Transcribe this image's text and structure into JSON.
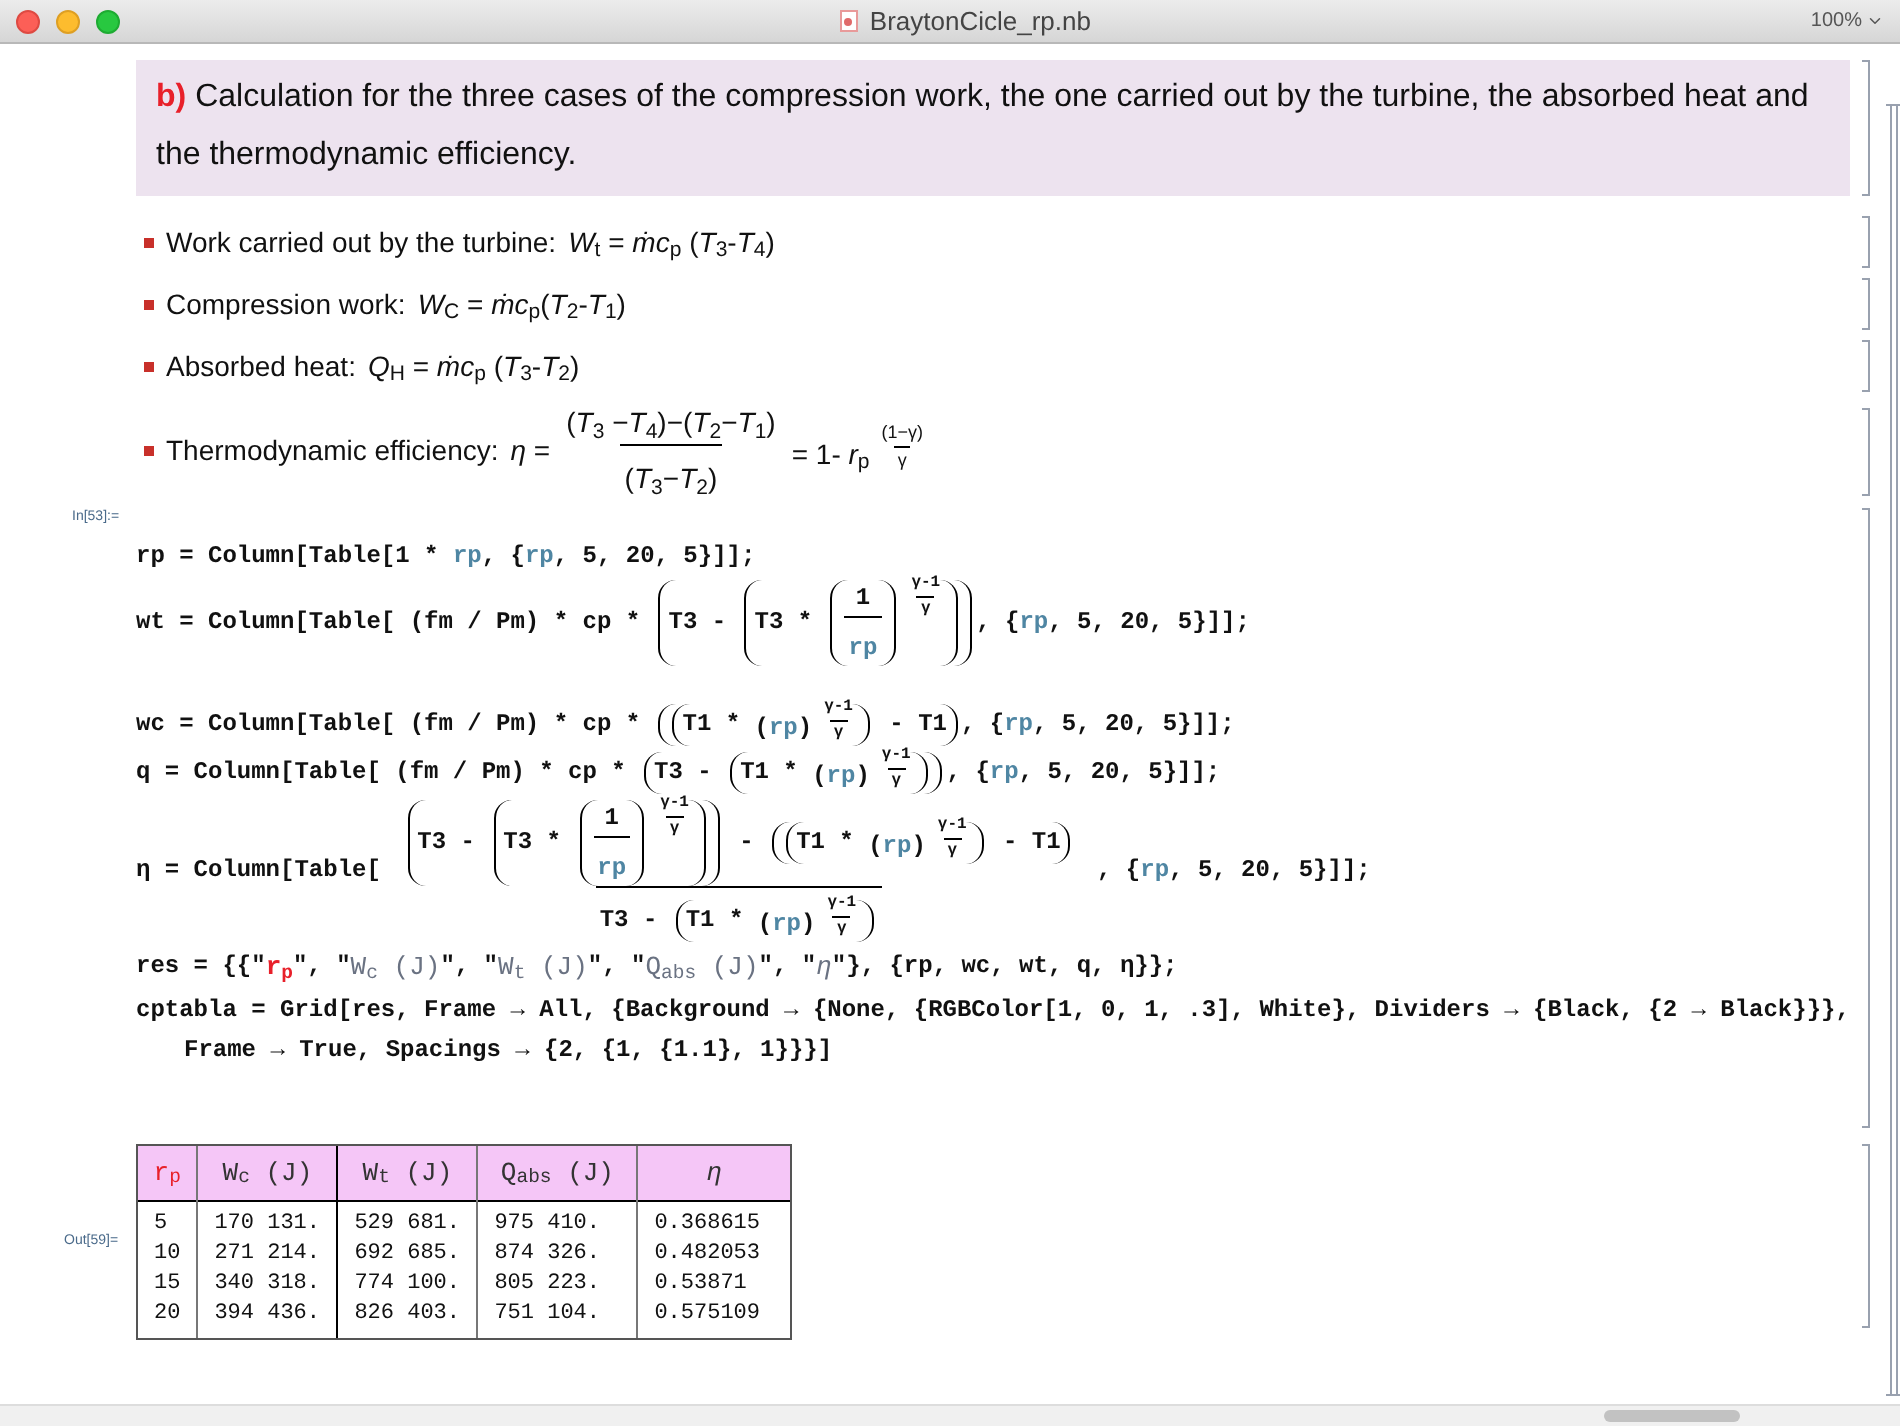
{
  "window": {
    "title": "BraytonCicle_rp.nb",
    "zoom": "100%"
  },
  "text_cell": {
    "label": "b)",
    "text": "Calculation for the three cases of the compression work, the one carried out by the turbine, the absorbed heat and the thermodynamic efficiency."
  },
  "bullets": [
    {
      "label": "Work carried out by the turbine:",
      "math": [
        {
          "kind": "math",
          "text": "*W*$_{t}$ = *ṁc*$_{p}$ (*T*$_{3}$-*T*$_{4}$)"
        }
      ]
    },
    {
      "label": "Compression work:",
      "math": [
        {
          "kind": "math",
          "text": "*W*$_{C}$ = *ṁc*$_{p}$(*T*$_{2}$-*T*$_{1}$)"
        }
      ]
    },
    {
      "label": "Absorbed heat:",
      "math": [
        {
          "kind": "math",
          "text": "*Q*$_{H}$ = *ṁc*$_{p}$ (*T*$_{3}$-*T*$_{2}$)"
        }
      ]
    },
    {
      "label": "Thermodynamic efficiency:",
      "math": [
        {
          "kind": "math",
          "text": "*η* ="
        },
        {
          "kind": "fraction",
          "numerator": [
            {
              "kind": "math",
              "text": "(*T*$_{3}$ −*T*$_{4}$)−(*T*$_{2}$−*T*$_{1}$)"
            }
          ],
          "denominator": [
            {
              "kind": "math",
              "text": "(*T*$_{3}$−*T*$_{2}$)"
            }
          ]
        },
        {
          "kind": "power",
          "base": [
            {
              "kind": "math",
              "text": "= 1- *r*$_{p}$"
            }
          ],
          "exponent": [
            {
              "kind": "fraction",
              "numerator": [
                {
                  "kind": "math",
                  "text": "(1−γ)"
                }
              ],
              "denominator": [
                {
                  "kind": "math",
                  "text": "γ"
                }
              ]
            }
          ]
        }
      ]
    }
  ],
  "input": {
    "label": "In[53]:=",
    "lines": [
      [
        {
          "kind": "code",
          "text": "rp = Column[Table[1 * "
        },
        {
          "kind": "var",
          "text": "rp"
        },
        {
          "kind": "code",
          "text": ", {"
        },
        {
          "kind": "var",
          "text": "rp"
        },
        {
          "kind": "code",
          "text": ", 5, 20, 5}]];"
        }
      ],
      [
        {
          "kind": "code",
          "text": "wt = Column[Table[ (fm / Pm) * cp * "
        },
        {
          "kind": "paren",
          "content": [
            {
              "kind": "code",
              "text": "T3 - "
            },
            {
              "kind": "paren",
              "content": [
                {
                  "kind": "code",
                  "text": "T3 * "
                },
                {
                  "kind": "power",
                  "base": [
                    {
                      "kind": "paren",
                      "content": [
                        {
                          "kind": "fraction",
                          "numerator": [
                            {
                              "kind": "code",
                              "text": "1"
                            }
                          ],
                          "denominator": [
                            {
                              "kind": "var",
                              "text": "rp"
                            }
                          ]
                        }
                      ]
                    }
                  ],
                  "exponent": [
                    {
                      "kind": "fraction",
                      "numerator": [
                        {
                          "kind": "code",
                          "text": "γ-1"
                        }
                      ],
                      "denominator": [
                        {
                          "kind": "code",
                          "text": "γ"
                        }
                      ]
                    }
                  ]
                }
              ]
            }
          ]
        },
        {
          "kind": "code",
          "text": ", {"
        },
        {
          "kind": "var",
          "text": "rp"
        },
        {
          "kind": "code",
          "text": ", 5, 20, 5}]];"
        }
      ],
      [
        {
          "kind": "code",
          "text": "wc = Column[Table[ (fm / Pm) * cp * "
        },
        {
          "kind": "paren",
          "content": [
            {
              "kind": "paren",
              "content": [
                {
                  "kind": "code",
                  "text": "T1 * "
                },
                {
                  "kind": "power",
                  "base": [
                    {
                      "kind": "code",
                      "text": "("
                    },
                    {
                      "kind": "var",
                      "text": "rp"
                    },
                    {
                      "kind": "code",
                      "text": ")"
                    }
                  ],
                  "exponent": [
                    {
                      "kind": "fraction",
                      "numerator": [
                        {
                          "kind": "code",
                          "text": "γ-1"
                        }
                      ],
                      "denominator": [
                        {
                          "kind": "code",
                          "text": "γ"
                        }
                      ]
                    }
                  ]
                }
              ]
            },
            {
              "kind": "code",
              "text": " - T1"
            }
          ]
        },
        {
          "kind": "code",
          "text": ", {"
        },
        {
          "kind": "var",
          "text": "rp"
        },
        {
          "kind": "code",
          "text": ", 5, 20, 5}]];"
        }
      ],
      [
        {
          "kind": "code",
          "text": "q = Column[Table[ (fm / Pm) * cp * "
        },
        {
          "kind": "paren",
          "content": [
            {
              "kind": "code",
              "text": "T3 - "
            },
            {
              "kind": "paren",
              "content": [
                {
                  "kind": "code",
                  "text": "T1 * "
                },
                {
                  "kind": "power",
                  "base": [
                    {
                      "kind": "code",
                      "text": "("
                    },
                    {
                      "kind": "var",
                      "text": "rp"
                    },
                    {
                      "kind": "code",
                      "text": ")"
                    }
                  ],
                  "exponent": [
                    {
                      "kind": "fraction",
                      "numerator": [
                        {
                          "kind": "code",
                          "text": "γ-1"
                        }
                      ],
                      "denominator": [
                        {
                          "kind": "code",
                          "text": "γ"
                        }
                      ]
                    }
                  ]
                }
              ]
            }
          ]
        },
        {
          "kind": "code",
          "text": ", {"
        },
        {
          "kind": "var",
          "text": "rp"
        },
        {
          "kind": "code",
          "text": ", 5, 20, 5}]];"
        }
      ],
      [
        {
          "kind": "code",
          "text": "η = Column[Table[ "
        },
        {
          "kind": "fraction",
          "numerator": [
            {
              "kind": "paren",
              "content": [
                {
                  "kind": "code",
                  "text": "T3 - "
                },
                {
                  "kind": "paren",
                  "content": [
                    {
                      "kind": "code",
                      "text": "T3 * "
                    },
                    {
                      "kind": "power",
                      "base": [
                        {
                          "kind": "paren",
                          "content": [
                            {
                              "kind": "fraction",
                              "numerator": [
                                {
                                  "kind": "code",
                                  "text": "1"
                                }
                              ],
                              "denominator": [
                                {
                                  "kind": "var",
                                  "text": "rp"
                                }
                              ]
                            }
                          ]
                        }
                      ],
                      "exponent": [
                        {
                          "kind": "fraction",
                          "numerator": [
                            {
                              "kind": "code",
                              "text": "γ-1"
                            }
                          ],
                          "denominator": [
                            {
                              "kind": "code",
                              "text": "γ"
                            }
                          ]
                        }
                      ]
                    }
                  ]
                }
              ]
            },
            {
              "kind": "code",
              "text": " - "
            },
            {
              "kind": "paren",
              "content": [
                {
                  "kind": "paren",
                  "content": [
                    {
                      "kind": "code",
                      "text": "T1 * "
                    },
                    {
                      "kind": "power",
                      "base": [
                        {
                          "kind": "code",
                          "text": "("
                        },
                        {
                          "kind": "var",
                          "text": "rp"
                        },
                        {
                          "kind": "code",
                          "text": ")"
                        }
                      ],
                      "exponent": [
                        {
                          "kind": "fraction",
                          "numerator": [
                            {
                              "kind": "code",
                              "text": "γ-1"
                            }
                          ],
                          "denominator": [
                            {
                              "kind": "code",
                              "text": "γ"
                            }
                          ]
                        }
                      ]
                    }
                  ]
                },
                {
                  "kind": "code",
                  "text": " - T1"
                }
              ]
            }
          ],
          "denominator": [
            {
              "kind": "code",
              "text": "T3 - "
            },
            {
              "kind": "paren",
              "content": [
                {
                  "kind": "code",
                  "text": "T1 * "
                },
                {
                  "kind": "power",
                  "base": [
                    {
                      "kind": "code",
                      "text": "("
                    },
                    {
                      "kind": "var",
                      "text": "rp"
                    },
                    {
                      "kind": "code",
                      "text": ")"
                    }
                  ],
                  "exponent": [
                    {
                      "kind": "fraction",
                      "numerator": [
                        {
                          "kind": "code",
                          "text": "γ-1"
                        }
                      ],
                      "denominator": [
                        {
                          "kind": "code",
                          "text": "γ"
                        }
                      ]
                    }
                  ]
                }
              ]
            }
          ]
        },
        {
          "kind": "code",
          "text": " , {"
        },
        {
          "kind": "var",
          "text": "rp"
        },
        {
          "kind": "code",
          "text": ", 5, 20, 5}]];"
        }
      ],
      [
        {
          "kind": "code",
          "text": "res = {{\""
        },
        {
          "kind": "red_string",
          "text": "r$_{p}$"
        },
        {
          "kind": "code",
          "text": "\", \""
        },
        {
          "kind": "string",
          "text": "W$_{c}$ (J)"
        },
        {
          "kind": "code",
          "text": "\", \""
        },
        {
          "kind": "string",
          "text": "W$_{t}$ (J)"
        },
        {
          "kind": "code",
          "text": "\", \""
        },
        {
          "kind": "string",
          "text": "Q$_{abs}$ (J)"
        },
        {
          "kind": "code",
          "text": "\", \""
        },
        {
          "kind": "string",
          "text": "*η*"
        },
        {
          "kind": "code",
          "text": "\"}, {rp, wc, wt, q, η}};"
        }
      ],
      [
        {
          "kind": "code",
          "text": "cptabla = Grid[res, Frame → All, {Background → {None, {RGBColor[1, 0, 1, .3], White}, Dividers → {Black, {2 → Black}}},"
        },
        {
          "kind": "break"
        },
        {
          "kind": "code",
          "text": "Frame → True, Spacings → {2, {1, {1.1}, 1}}}]"
        }
      ]
    ]
  },
  "output": {
    "label": "Out[59]=",
    "columns": [
      {
        "label": "r$_{p}$",
        "color": "#e8202a"
      },
      {
        "label": "W$_{c}$ (J)",
        "color": "#333333"
      },
      {
        "label": "W$_{t}$ (J)",
        "color": "#333333"
      },
      {
        "label": "Q$_{abs}$ (J)",
        "color": "#333333"
      },
      {
        "label": "*η*",
        "color": "#333333"
      }
    ],
    "rows": [
      [
        "5",
        "170 131.",
        "529 681.",
        "975 410.",
        "0.368615"
      ],
      [
        "10",
        "271 214.",
        "692 685.",
        "874 326.",
        "0.482053"
      ],
      [
        "15",
        "340 318.",
        "774 100.",
        "805 223.",
        "0.53871"
      ],
      [
        "20",
        "394 436.",
        "826 403.",
        "751 104.",
        "0.575109"
      ]
    ]
  }
}
